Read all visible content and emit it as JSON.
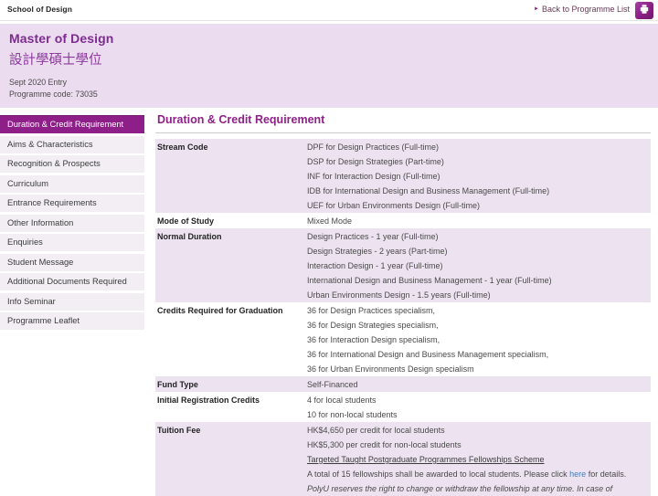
{
  "colors": {
    "accent_purple": "#8E1F88",
    "title_purple": "#7D2C90",
    "banner_bg": "#EBDCEF",
    "row_alt_bg": "#EDE2F0",
    "sidebar_bg": "#F2EEF4",
    "link_blue": "#3F7FC4"
  },
  "topbar": {
    "school": "School of Design",
    "back_label": "Back to Programme List",
    "back_arrow": "►",
    "print_icon": "printer-icon"
  },
  "banner": {
    "title_en": "Master of Design",
    "title_zh": "設計學碩士學位",
    "entry": "Sept 2020 Entry",
    "code": "Programme code: 73035"
  },
  "sidebar": {
    "items": [
      {
        "label": "Duration & Credit Requirement",
        "active": true
      },
      {
        "label": "Aims & Characteristics",
        "active": false
      },
      {
        "label": "Recognition & Prospects",
        "active": false
      },
      {
        "label": "Curriculum",
        "active": false
      },
      {
        "label": "Entrance Requirements",
        "active": false
      },
      {
        "label": "Other Information",
        "active": false
      },
      {
        "label": "Enquiries",
        "active": false
      },
      {
        "label": "Student Message",
        "active": false
      },
      {
        "label": "Additional Documents Required",
        "active": false
      },
      {
        "label": "Info Seminar",
        "active": false
      },
      {
        "label": "Programme Leaflet",
        "active": false
      }
    ]
  },
  "main": {
    "heading": "Duration & Credit Requirement",
    "rows": [
      {
        "label": "Stream Code",
        "values": [
          "DPF for Design Practices (Full-time)",
          "DSP for Design Strategies (Part-time)",
          "INF for Interaction Design (Full-time)",
          "IDB for International Design and Business Management (Full-time)",
          "UEF for Urban Environments Design (Full-time)"
        ]
      },
      {
        "label": "Mode of Study",
        "values": [
          "Mixed Mode"
        ]
      },
      {
        "label": "Normal Duration",
        "values": [
          "Design Practices - 1 year (Full-time)",
          "Design Strategies - 2 years (Part-time)",
          "Interaction Design - 1 year (Full-time)",
          "International Design and Business Management - 1 year (Full-time)",
          "Urban Environments Design - 1.5 years (Full-time)"
        ]
      },
      {
        "label": "Credits Required for Graduation",
        "values": [
          "36 for Design Practices specialism,",
          "36 for Design Strategies specialism,",
          "36 for Interaction Design specialism,",
          "36 for International Design and Business Management specialism,",
          "36 for Urban Environments Design specialism"
        ]
      },
      {
        "label": "Fund Type",
        "values": [
          "Self-Financed"
        ]
      },
      {
        "label": "Initial Registration Credits",
        "values": [
          "4 for local students",
          "10 for non-local students"
        ]
      }
    ],
    "tuition": {
      "label": "Tuition Fee",
      "line1": "HK$4,650 per credit for local students",
      "line2": "HK$5,300 per credit for non-local students",
      "scheme_link": "Targeted Taught Postgraduate Programmes Fellowships Scheme",
      "fellowship_before": "A total of 15 fellowships shall be awarded to local students. Please click ",
      "fellowship_link": "here",
      "fellowship_after": " for details.",
      "disclaimer": "PolyU reserves the right to change or withdraw the fellowship at any time. In case of"
    }
  }
}
